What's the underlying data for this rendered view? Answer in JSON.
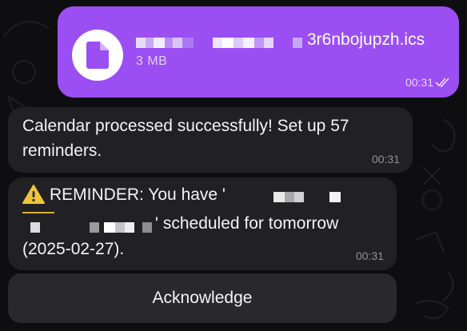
{
  "outgoing_file": {
    "icon": "file-icon",
    "name_visible_tail": "3r6nbojupzh.ics",
    "size": "3 MB",
    "time": "00:31",
    "status_icon": "double-check-icon"
  },
  "messages": [
    {
      "text": "Calendar processed successfully! Set up 57 reminders.",
      "time": "00:31"
    },
    {
      "warning_icon": "warning-icon",
      "line1": "REMINDER: You have '",
      "line2": "' scheduled for tomorrow",
      "line3": "(2025-02-27).",
      "time": "00:31"
    }
  ],
  "inline_button": {
    "label": "Acknowledge"
  },
  "colors": {
    "outgoing_bubble": "#9b4ff2",
    "incoming_bubble": "#212123",
    "background": "#0e0e10",
    "button": "#29292c"
  }
}
